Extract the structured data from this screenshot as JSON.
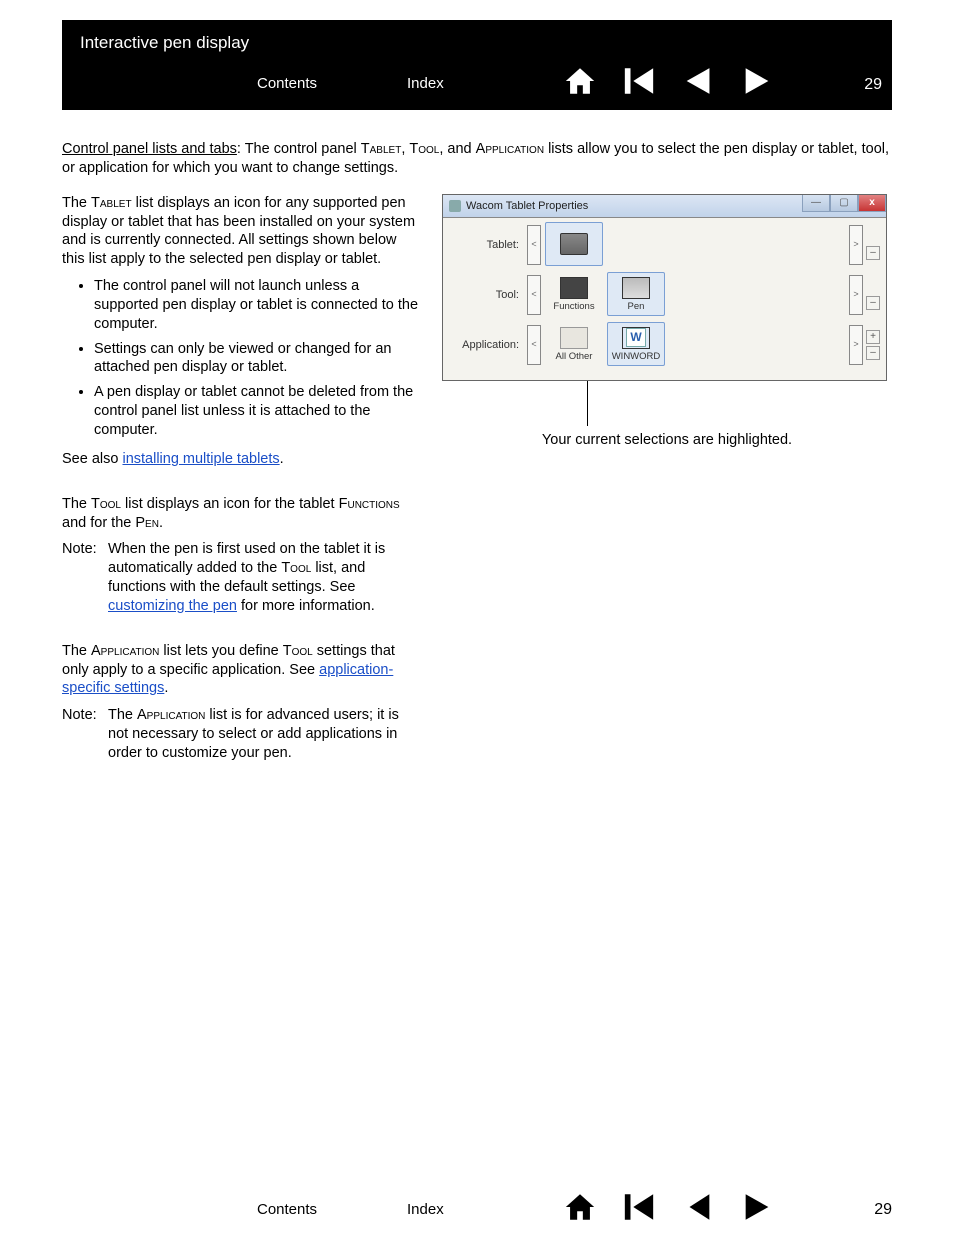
{
  "header": {
    "title": "Interactive pen display",
    "contents": "Contents",
    "index": "Index",
    "page": "29"
  },
  "intro": {
    "lead": "Control panel lists and tabs",
    "rest1": ": The control panel ",
    "t1": "Tablet",
    "c1": ", ",
    "t2": "Tool",
    "c2": ", and ",
    "t3": "Application",
    "rest2": " lists allow you to select the pen display or tablet, tool, or application for which you want to change settings."
  },
  "left": {
    "p1a": "The ",
    "p1b": "Tablet",
    "p1c": " list displays an icon for any supported pen display or tablet that has been installed on your system and is currently connected.  All settings shown below this list apply to the selected pen display or tablet.",
    "bullets": [
      "The control panel will not launch unless a supported pen display or tablet is connected to the computer.",
      "Settings can only be viewed or changed for an attached pen display or tablet.",
      "A pen display or tablet cannot be deleted from the control panel list unless it is attached to the computer."
    ],
    "see_pre": "See also ",
    "see_link": "installing multiple tablets",
    "see_post": ".",
    "p2a": "The ",
    "p2b": "Tool",
    "p2c": " list displays an icon for the tablet ",
    "p2d": "Functions",
    "p2e": " and for the ",
    "p2f": "Pen",
    "p2g": ".",
    "note1_label": "Note:",
    "note1a": "When the pen is first used on the tablet it is automatically added to the ",
    "note1b": "Tool",
    "note1c": " list, and functions with the default settings.  See ",
    "note1_link": "customizing the pen",
    "note1d": " for more information.",
    "p3a": "The ",
    "p3b": "Application",
    "p3c": " list lets you define ",
    "p3d": "Tool",
    "p3e": " settings that only apply to a specific application.  See ",
    "p3_link": "application-specific settings",
    "p3f": ".",
    "note2_label": "Note:",
    "note2a": "The ",
    "note2b": "Application",
    "note2c": " list is for advanced users; it is not necessary to select or add applications in order to customize your pen."
  },
  "screenshot": {
    "title": "Wacom Tablet Properties",
    "row_tablet": "Tablet:",
    "row_tool": "Tool:",
    "row_app": "Application:",
    "functions": "Functions",
    "pen": "Pen",
    "allother": "All Other",
    "winword": "WINWORD"
  },
  "callout": "Your current selections are highlighted.",
  "footer": {
    "contents": "Contents",
    "index": "Index",
    "page": "29"
  }
}
